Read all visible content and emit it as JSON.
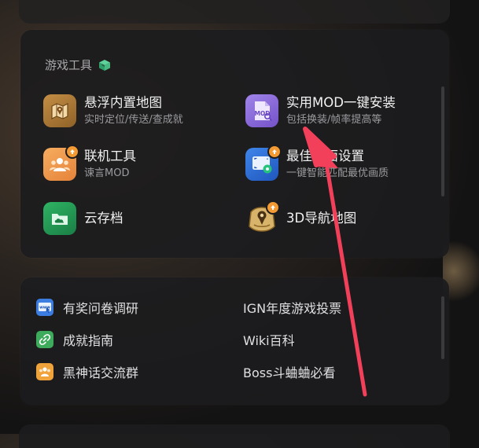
{
  "section": {
    "title": "游戏工具"
  },
  "tools": [
    {
      "name": "悬浮内置地图",
      "sub": "实时定位/传送/查成就",
      "icon": "map-pin-icon"
    },
    {
      "name": "实用MOD一键安装",
      "sub": "包括换装/帧率提高等",
      "icon": "mod-file-icon",
      "icon_text": "MOD"
    },
    {
      "name": "联机工具",
      "sub": "谏言MOD",
      "icon": "group-users-icon"
    },
    {
      "name": "最佳画面设置",
      "sub": "一键智能匹配最优画质",
      "icon": "display-settings-icon"
    },
    {
      "name": "云存档",
      "sub": "",
      "icon": "cloud-folder-icon"
    },
    {
      "name": "3D导航地图",
      "sub": "",
      "icon": "3d-map-icon"
    }
  ],
  "links": [
    {
      "label": "有奖问卷调研",
      "icon": "www-cursor-icon"
    },
    {
      "label": "IGN年度游戏投票",
      "icon": ""
    },
    {
      "label": "成就指南",
      "icon": "link-icon"
    },
    {
      "label": "Wiki百科",
      "icon": ""
    },
    {
      "label": "黑神话交流群",
      "icon": "group-icon"
    },
    {
      "label": "Boss斗蛐蛐必看",
      "icon": ""
    }
  ],
  "colors": {
    "map_icon": "#b8823a",
    "mod_icon": "#8b6bd6",
    "coop_icon": "#f19a4a",
    "display_icon": "#2e6fd8",
    "cloud_icon": "#1f9a52",
    "nav_icon": "#c9a35a",
    "annotation_arrow": "#f2405a"
  }
}
